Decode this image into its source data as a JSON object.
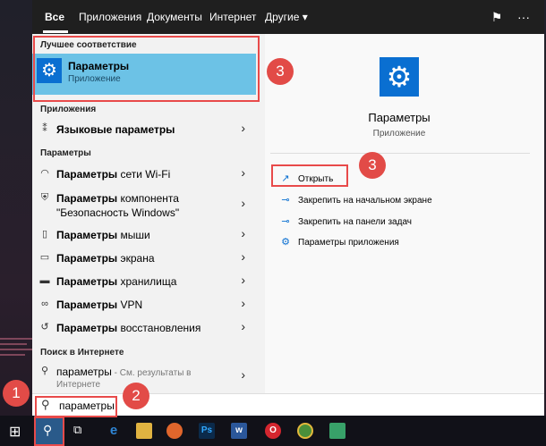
{
  "tabs": [
    {
      "label": "Все",
      "active": true
    },
    {
      "label": "Приложения"
    },
    {
      "label": "Документы"
    },
    {
      "label": "Интернет"
    },
    {
      "label": "Другие"
    }
  ],
  "best_match": {
    "section_label": "Лучшее соответствие",
    "title": "Параметры",
    "subtitle": "Приложение"
  },
  "apps_section": {
    "label": "Приложения",
    "items": [
      {
        "bold": "Языковые параметры",
        "rest": "",
        "icon": "language-icon"
      }
    ]
  },
  "settings_section": {
    "label": "Параметры",
    "items": [
      {
        "bold": "Параметры",
        "rest": " сети Wi-Fi",
        "icon": "wifi-icon"
      },
      {
        "bold": "Параметры",
        "rest": " компонента",
        "line2": "\"Безопасность Windows\"",
        "icon": "shield-icon"
      },
      {
        "bold": "Параметры",
        "rest": " мыши",
        "icon": "mouse-icon"
      },
      {
        "bold": "Параметры",
        "rest": " экрана",
        "icon": "display-icon"
      },
      {
        "bold": "Параметры",
        "rest": " хранилища",
        "icon": "storage-icon"
      },
      {
        "bold": "Параметры",
        "rest": " VPN",
        "icon": "vpn-icon"
      },
      {
        "bold": "Параметры",
        "rest": " восстановления",
        "icon": "recovery-icon"
      }
    ]
  },
  "web_section": {
    "label": "Поиск в Интернете",
    "query": "параметры",
    "hint": " - См. результаты в",
    "hint2": "Интернете"
  },
  "detail": {
    "title": "Параметры",
    "subtitle": "Приложение",
    "actions": [
      {
        "label": "Открыть",
        "icon": "open-icon"
      },
      {
        "label": "Закрепить на начальном экране",
        "icon": "pin-icon"
      },
      {
        "label": "Закрепить на панели задач",
        "icon": "pin-taskbar-icon"
      },
      {
        "label": "Параметры приложения",
        "icon": "gear-icon"
      }
    ]
  },
  "search": {
    "value": "параметры"
  },
  "annotations": [
    "1",
    "2",
    "3",
    "3"
  ],
  "colors": {
    "accent": "#0a6fd1",
    "best_match_bg": "#6cc2e6",
    "highlight": "#e84a4a"
  }
}
